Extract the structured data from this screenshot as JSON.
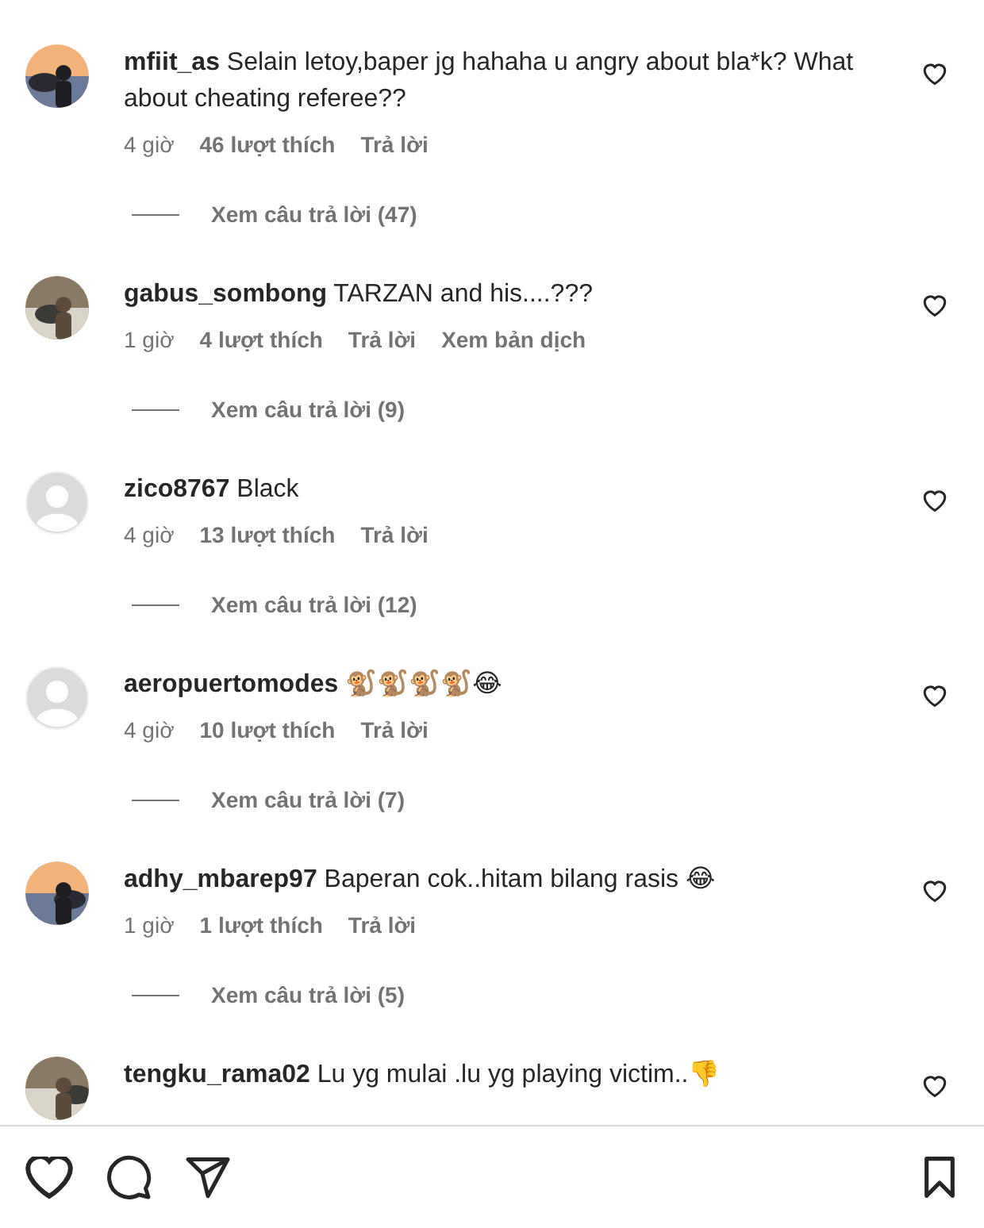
{
  "comments": [
    {
      "username": "mfiit_as",
      "text": "Selain letoy,baper jg hahaha u angry about bla*k? What about cheating referee??",
      "liked": false,
      "meta": {
        "time": "4 giờ",
        "likes": "46 lượt thích",
        "reply": "Trả lời"
      },
      "view_replies": "Xem câu trả lời (47)"
    },
    {
      "username": "gabus_sombong",
      "text": "TARZAN and his....???",
      "liked": false,
      "meta": {
        "time": "1 giờ",
        "likes": "4 lượt thích",
        "reply": "Trả lời",
        "translate": "Xem bản dịch"
      },
      "view_replies": "Xem câu trả lời (9)"
    },
    {
      "avatar": {
        "kind": "default"
      },
      "username": "zico8767",
      "text": "Black",
      "liked": false,
      "meta": {
        "time": "4 giờ",
        "likes": "13 lượt thích",
        "reply": "Trả lời"
      },
      "view_replies": "Xem câu trả lời (12)"
    },
    {
      "avatar": {
        "kind": "default"
      },
      "username": "aeropuertomodes",
      "text": "🐒🐒🐒🐒😂",
      "liked": false,
      "meta": {
        "time": "4 giờ",
        "likes": "10 lượt thích",
        "reply": "Trả lời"
      },
      "view_replies": "Xem câu trả lời (7)"
    },
    {
      "username": "adhy_mbarep97",
      "text": "Baperan cok..hitam bilang rasis 😂",
      "liked": false,
      "meta": {
        "time": "1 giờ",
        "likes": "1 lượt thích",
        "reply": "Trả lời"
      },
      "view_replies": "Xem câu trả lời (5)"
    },
    {
      "username": "tengku_rama02",
      "text": "Lu yg mulai .lu yg playing victim..👎",
      "liked": false
    }
  ],
  "action_bar": {
    "liked": false,
    "saved": false
  }
}
